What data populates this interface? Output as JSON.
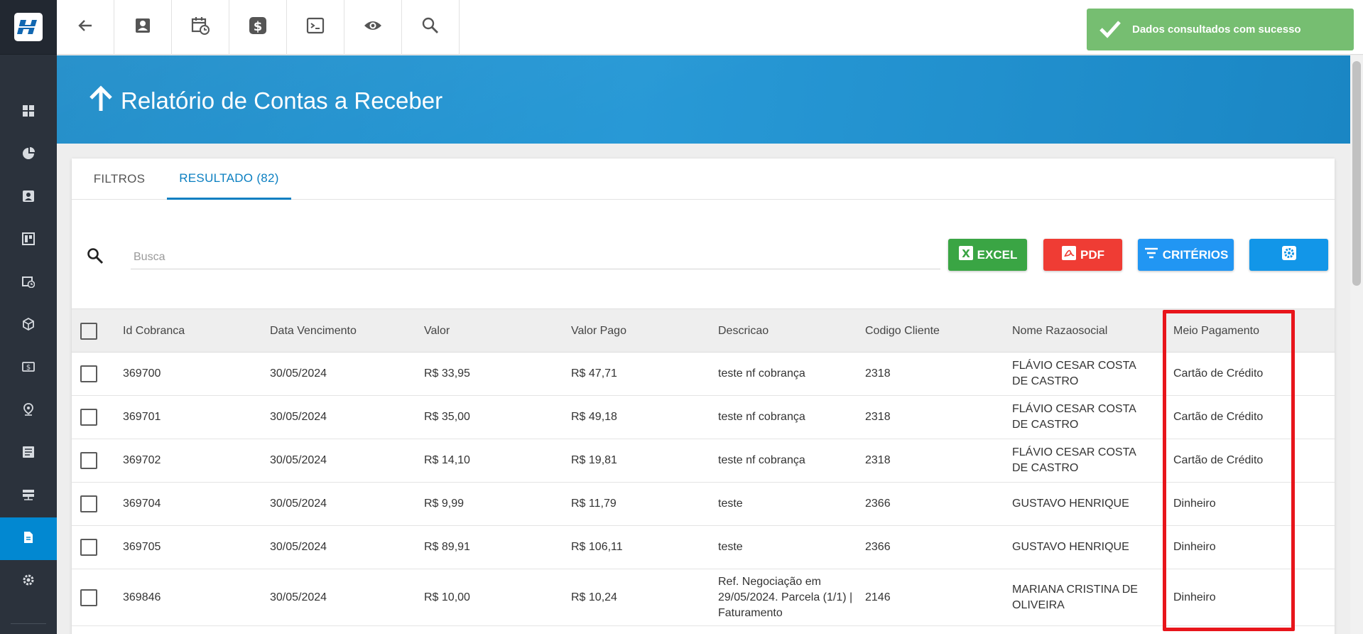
{
  "toast": {
    "message": "Dados consultados com sucesso"
  },
  "page": {
    "title": "Relatório de Contas a Receber"
  },
  "tabs": [
    {
      "label": "FILTROS",
      "active": false
    },
    {
      "label": "RESULTADO (82)",
      "active": true
    }
  ],
  "search": {
    "placeholder": "Busca",
    "value": ""
  },
  "actions": {
    "excel": "EXCEL",
    "pdf": "PDF",
    "criterios": "CRITÉRIOS"
  },
  "colors": {
    "sidebar": "#2b323c",
    "accent": "#0288d1",
    "excel": "#3aa544",
    "pdf": "#ef3c34",
    "criterios": "#2196f3",
    "toast": "#6fbb6a",
    "highlight": "#e8151b"
  },
  "sidebar_icons": [
    "dashboard-icon",
    "pie-chart-icon",
    "contact-icon",
    "board-icon",
    "calendar-clock-icon",
    "box-icon",
    "money-icon",
    "location-icon",
    "list-icon",
    "server-icon",
    "document-icon",
    "gear-icon"
  ],
  "top_icons": [
    "back-arrow-icon",
    "contact-icon",
    "calendar-clock-icon",
    "dollar-icon",
    "terminal-icon",
    "eye-icon",
    "search-icon"
  ],
  "table": {
    "columns": [
      "Id Cobranca",
      "Data Vencimento",
      "Valor",
      "Valor Pago",
      "Descricao",
      "Codigo Cliente",
      "Nome Razaosocial",
      "Meio Pagamento"
    ],
    "rows": [
      {
        "id": "369700",
        "venc": "30/05/2024",
        "valor": "R$ 33,95",
        "pago": "R$ 47,71",
        "desc": "teste nf cobrança",
        "cod": "2318",
        "nome": "FLÁVIO CESAR COSTA DE CASTRO",
        "meio": "Cartão de Crédito"
      },
      {
        "id": "369701",
        "venc": "30/05/2024",
        "valor": "R$ 35,00",
        "pago": "R$ 49,18",
        "desc": "teste nf cobrança",
        "cod": "2318",
        "nome": "FLÁVIO CESAR COSTA DE CASTRO",
        "meio": "Cartão de Crédito"
      },
      {
        "id": "369702",
        "venc": "30/05/2024",
        "valor": "R$ 14,10",
        "pago": "R$ 19,81",
        "desc": "teste nf cobrança",
        "cod": "2318",
        "nome": "FLÁVIO CESAR COSTA DE CASTRO",
        "meio": "Cartão de Crédito"
      },
      {
        "id": "369704",
        "venc": "30/05/2024",
        "valor": "R$ 9,99",
        "pago": "R$ 11,79",
        "desc": "teste",
        "cod": "2366",
        "nome": "GUSTAVO HENRIQUE",
        "meio": "Dinheiro"
      },
      {
        "id": "369705",
        "venc": "30/05/2024",
        "valor": "R$ 89,91",
        "pago": "R$ 106,11",
        "desc": "teste",
        "cod": "2366",
        "nome": "GUSTAVO HENRIQUE",
        "meio": "Dinheiro"
      },
      {
        "id": "369846",
        "venc": "30/05/2024",
        "valor": "R$ 10,00",
        "pago": "R$ 10,24",
        "desc": "Ref. Negociação em 29/05/2024. Parcela (1/1) | Faturamento",
        "cod": "2146",
        "nome": "MARIANA CRISTINA DE OLIVEIRA",
        "meio": "Dinheiro"
      }
    ]
  }
}
